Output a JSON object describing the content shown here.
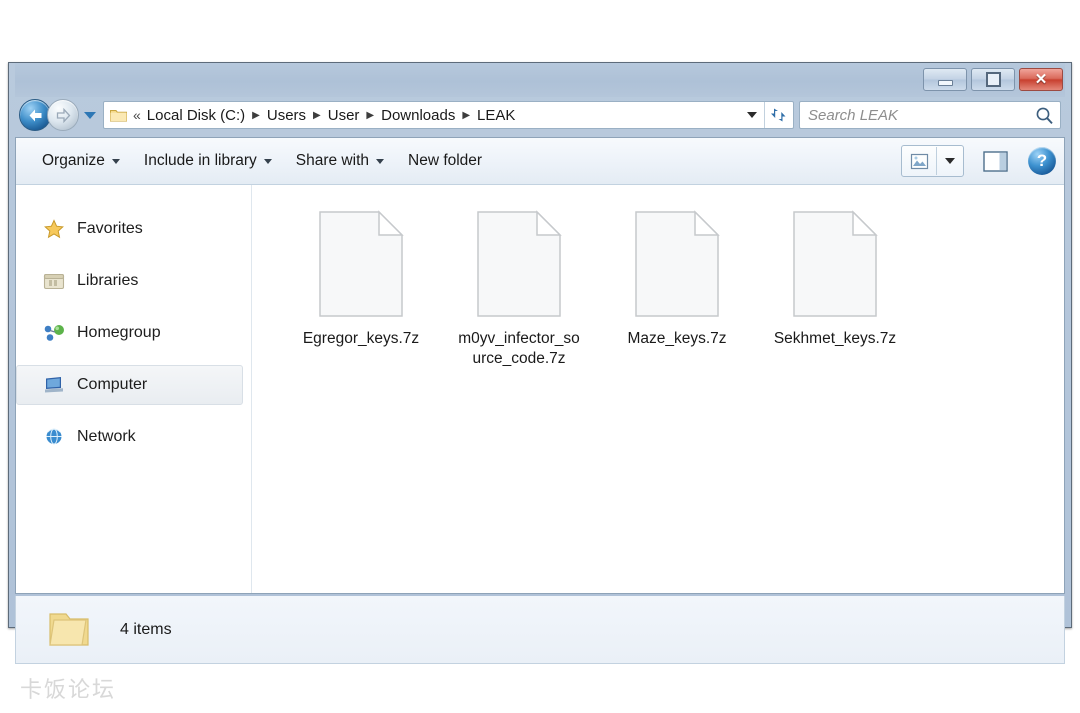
{
  "window": {
    "title": "",
    "controls": {
      "minimize_label": "Minimize",
      "maximize_label": "Maximize",
      "close_label": "✕"
    }
  },
  "navigation": {
    "back_label": "Back",
    "forward_label": "Forward",
    "history_dropdown_label": "Recent pages",
    "refresh_label": "Refresh"
  },
  "address": {
    "overflow_chevrons": "«",
    "crumbs": [
      {
        "label": "Local Disk (C:)"
      },
      {
        "label": "Users"
      },
      {
        "label": "User"
      },
      {
        "label": "Downloads"
      },
      {
        "label": "LEAK"
      }
    ],
    "separator": "▶"
  },
  "search": {
    "placeholder": "Search LEAK",
    "value": ""
  },
  "toolbar": {
    "items": [
      {
        "label": "Organize",
        "has_caret": true
      },
      {
        "label": "Include in library",
        "has_caret": true
      },
      {
        "label": "Share with",
        "has_caret": true
      },
      {
        "label": "New folder",
        "has_caret": false
      }
    ],
    "view_options_label": "Change your view",
    "view_dropdown_label": "More options",
    "preview_pane_label": "Show the preview pane",
    "help_label": "?"
  },
  "sidebar": {
    "items": [
      {
        "label": "Favorites",
        "icon": "star-icon",
        "selected": false
      },
      {
        "label": "Libraries",
        "icon": "libraries-icon",
        "selected": false
      },
      {
        "label": "Homegroup",
        "icon": "homegroup-icon",
        "selected": false
      },
      {
        "label": "Computer",
        "icon": "computer-icon",
        "selected": true
      },
      {
        "label": "Network",
        "icon": "network-icon",
        "selected": false
      }
    ]
  },
  "content": {
    "files": [
      {
        "name": "Egregor_keys.7z",
        "icon": "generic-file-icon"
      },
      {
        "name": "m0yv_infector_source_code.7z",
        "icon": "generic-file-icon"
      },
      {
        "name": "Maze_keys.7z",
        "icon": "generic-file-icon"
      },
      {
        "name": "Sekhmet_keys.7z",
        "icon": "generic-file-icon"
      }
    ]
  },
  "status": {
    "item_count_text": "4 items",
    "folder_icon": "folder-icon"
  },
  "watermark": {
    "text": "卡饭论坛"
  },
  "colors": {
    "window_frame": "#b4c6da",
    "close_button": "#c8402f",
    "accent_blue": "#1c5c96",
    "content_background": "#ffffff"
  }
}
